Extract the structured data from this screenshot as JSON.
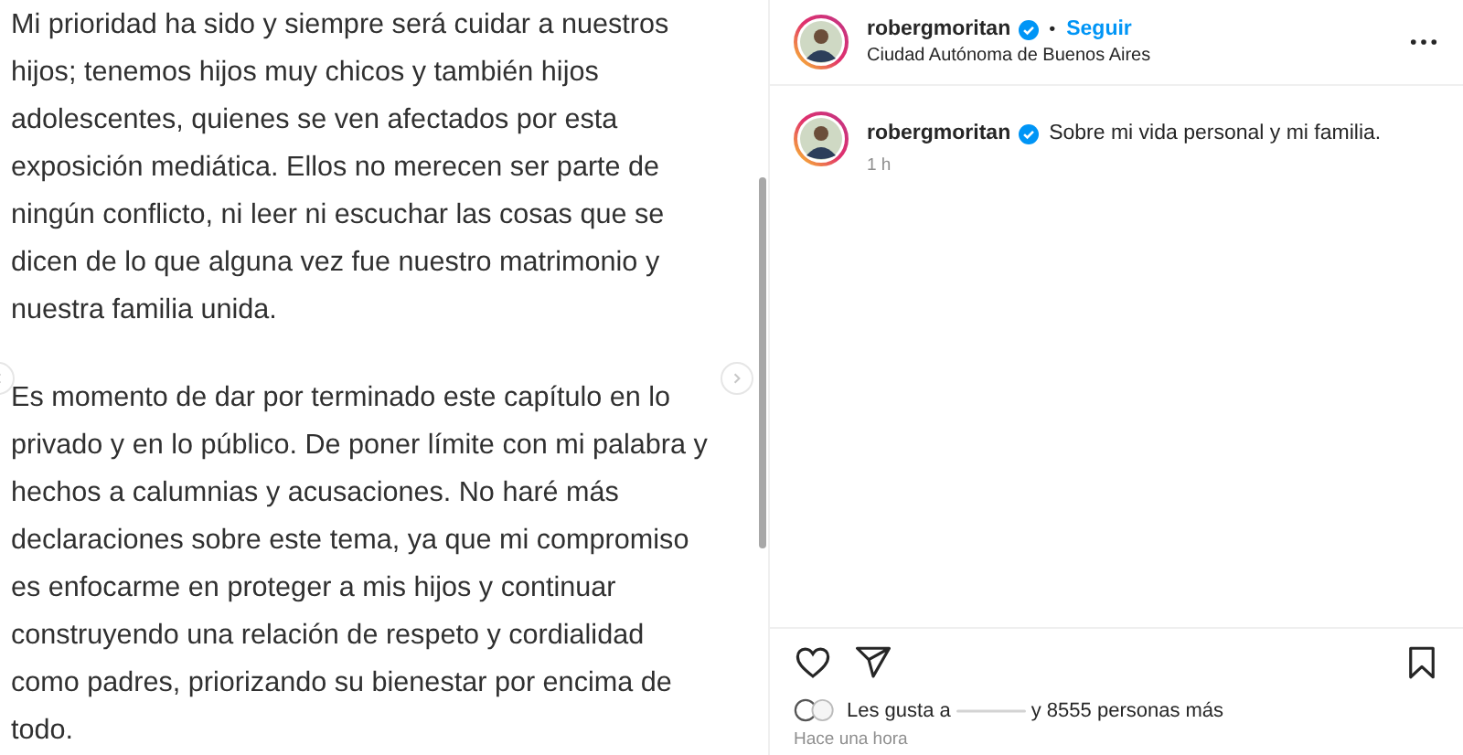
{
  "post_text": {
    "paragraphs": [
      {
        "lines": [
          "Mi prioridad ha sido y siempre será cuidar a nuestros",
          "hijos; tenemos hijos muy chicos y también hijos",
          "adolescentes, quienes se ven afectados por esta",
          "exposición mediática. Ellos no merecen ser parte de",
          "ningún conflicto, ni leer ni escuchar las cosas que se",
          "dicen de lo que alguna vez fue nuestro matrimonio y",
          "nuestra familia unida."
        ]
      },
      {
        "lines": [
          "Es momento de dar por terminado este capítulo en lo",
          "privado y en lo público. De poner límite con mi palabra y",
          "hechos a calumnias y acusaciones. No haré más",
          "declaraciones sobre este tema, ya que mi compromiso",
          "es enfocarme en proteger a mis hijos y continuar",
          "construyendo una relación de respeto y cordialidad",
          "como padres, priorizando su bienestar por encima de",
          "todo."
        ]
      }
    ]
  },
  "header": {
    "username": "robergmoritan",
    "verified": true,
    "separator": "•",
    "follow": "Seguir",
    "location": "Ciudad Autónoma de Buenos Aires"
  },
  "caption": {
    "username": "robergmoritan",
    "verified": true,
    "text": "Sobre mi vida personal y mi familia.",
    "time": "1 h"
  },
  "likes": {
    "prefix": "Les gusta a",
    "suffix": "y 8555 personas más"
  },
  "timestamp": "Hace una hora"
}
